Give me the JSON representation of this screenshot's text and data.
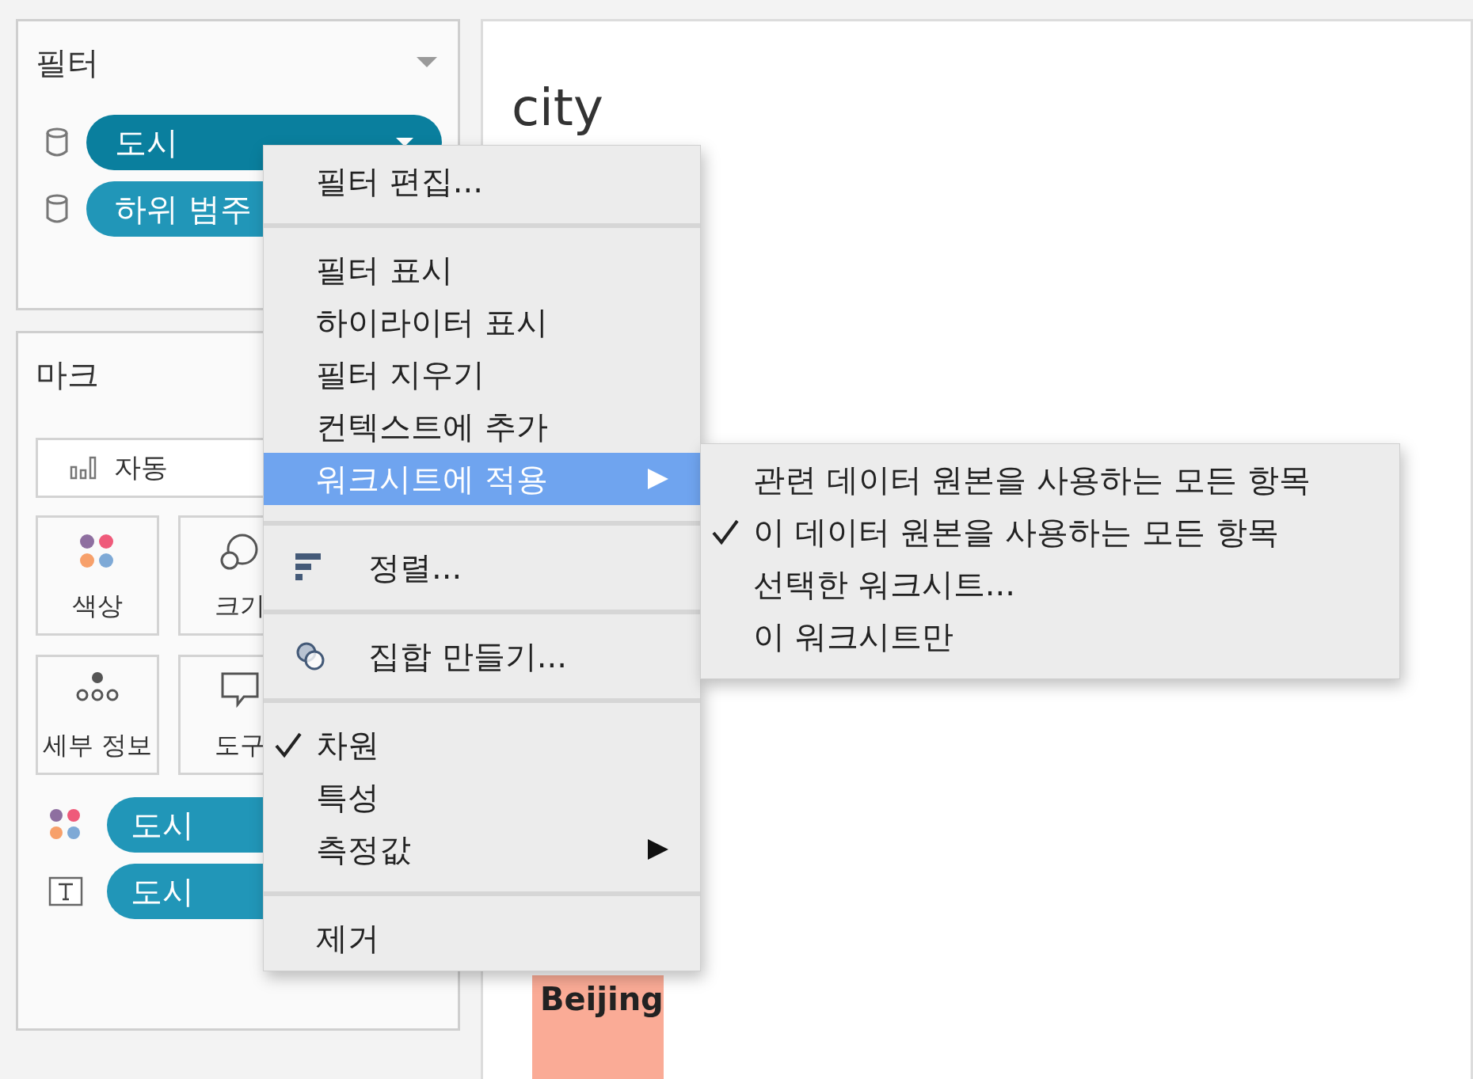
{
  "filters_panel": {
    "title": "필터",
    "pills": [
      {
        "label": "도시",
        "selected": true
      },
      {
        "label": "하위 범주",
        "selected": false
      }
    ]
  },
  "marks_panel": {
    "title": "마크",
    "mark_type": "자동",
    "cards": [
      {
        "kind": "color",
        "label": "색상"
      },
      {
        "kind": "size",
        "label": "크기"
      },
      {
        "kind": "detail",
        "label": "세부 정보"
      },
      {
        "kind": "tooltip",
        "label": "도구"
      }
    ],
    "pills": [
      {
        "kind": "color",
        "label": "도시"
      },
      {
        "kind": "text",
        "label": "도시"
      }
    ]
  },
  "view": {
    "title": "city",
    "bar_label": "Beijing"
  },
  "context_menu": {
    "groups": [
      [
        {
          "label": "필터 편집...",
          "kind": "plain",
          "checked": false,
          "selected": false,
          "submenu": false
        }
      ],
      [
        {
          "label": "필터 표시",
          "kind": "plain",
          "checked": false,
          "selected": false,
          "submenu": false
        },
        {
          "label": "하이라이터 표시",
          "kind": "plain",
          "checked": false,
          "selected": false,
          "submenu": false
        },
        {
          "label": "필터 지우기",
          "kind": "plain",
          "checked": false,
          "selected": false,
          "submenu": false
        },
        {
          "label": "컨텍스트에 추가",
          "kind": "plain",
          "checked": false,
          "selected": false,
          "submenu": false
        },
        {
          "label": "워크시트에 적용",
          "kind": "plain",
          "checked": false,
          "selected": true,
          "submenu": true
        }
      ],
      [
        {
          "label": "정렬...",
          "kind": "sort",
          "checked": false,
          "selected": false,
          "submenu": false
        }
      ],
      [
        {
          "label": "집합 만들기...",
          "kind": "set",
          "checked": false,
          "selected": false,
          "submenu": false
        }
      ],
      [
        {
          "label": "차원",
          "kind": "plain",
          "checked": true,
          "selected": false,
          "submenu": false
        },
        {
          "label": "특성",
          "kind": "plain",
          "checked": false,
          "selected": false,
          "submenu": false
        },
        {
          "label": "측정값",
          "kind": "plain",
          "checked": false,
          "selected": false,
          "submenu": true
        }
      ],
      [
        {
          "label": "제거",
          "kind": "plain",
          "checked": false,
          "selected": false,
          "submenu": false
        }
      ]
    ]
  },
  "submenu": {
    "items": [
      {
        "label": "관련 데이터 원본을 사용하는 모든 항목",
        "checked": false
      },
      {
        "label": "이 데이터 원본을 사용하는 모든 항목",
        "checked": true
      },
      {
        "label": "선택한 워크시트...",
        "checked": false
      },
      {
        "label": "이 워크시트만",
        "checked": false
      }
    ]
  }
}
